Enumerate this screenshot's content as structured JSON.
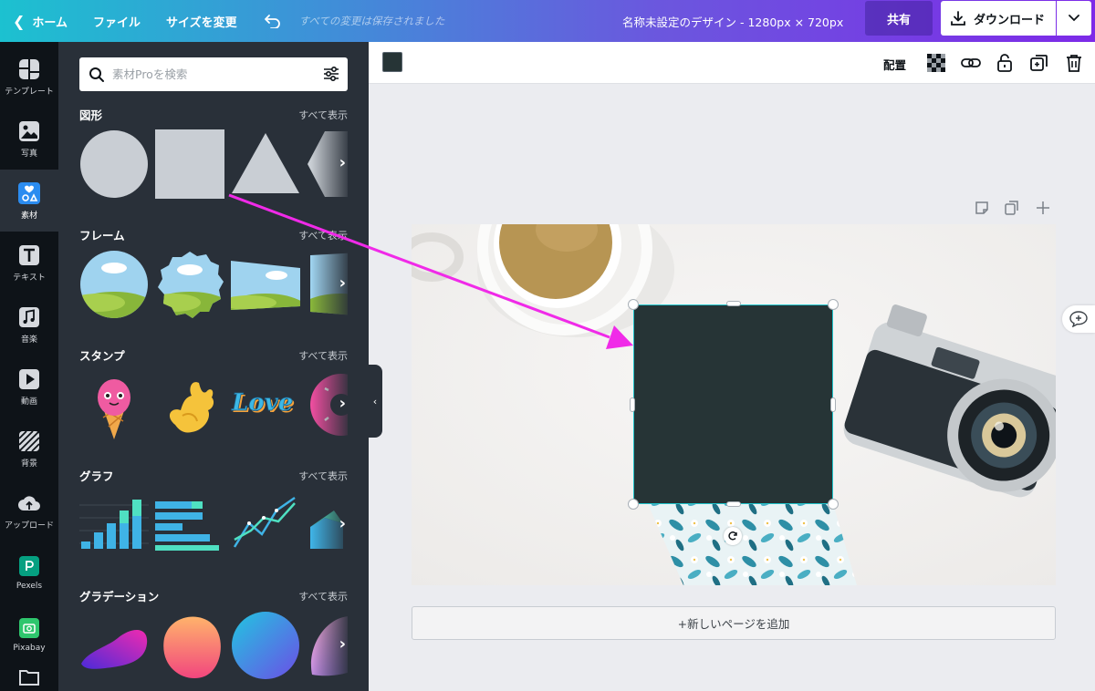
{
  "topbar": {
    "home": "ホーム",
    "file": "ファイル",
    "resize": "サイズを変更",
    "saved_status": "すべての変更は保存されました",
    "design_title": "名称未設定のデザイン - 1280px × 720px",
    "share": "共有",
    "download": "ダウンロード",
    "gradient_colors": [
      "#1cc1d0",
      "#7d2ae8"
    ]
  },
  "rail": {
    "items": [
      {
        "label": "テンプレート",
        "icon": "template-icon"
      },
      {
        "label": "写真",
        "icon": "photo-icon"
      },
      {
        "label": "素材",
        "icon": "elements-icon",
        "active": true
      },
      {
        "label": "テキスト",
        "icon": "text-icon"
      },
      {
        "label": "音楽",
        "icon": "music-icon"
      },
      {
        "label": "動画",
        "icon": "video-icon"
      },
      {
        "label": "背景",
        "icon": "background-icon"
      },
      {
        "label": "アップロード",
        "icon": "upload-icon"
      },
      {
        "label": "Pexels",
        "icon": "pexels-icon"
      },
      {
        "label": "Pixabay",
        "icon": "pixabay-icon"
      }
    ]
  },
  "panel": {
    "search_placeholder": "素材Proを検索",
    "see_all": "すべて表示",
    "sections": [
      {
        "title": "図形"
      },
      {
        "title": "フレーム"
      },
      {
        "title": "スタンプ"
      },
      {
        "title": "グラフ"
      },
      {
        "title": "グラデーション"
      }
    ],
    "stamp_text": "Love"
  },
  "toolbar": {
    "arrange": "配置",
    "swatch_color": "#263436"
  },
  "canvas": {
    "add_page": "+新しいページを追加",
    "selection_color": "#20c4cb",
    "shape_color": "#263436"
  },
  "annotation": {
    "arrow_color": "#f02ae8"
  }
}
